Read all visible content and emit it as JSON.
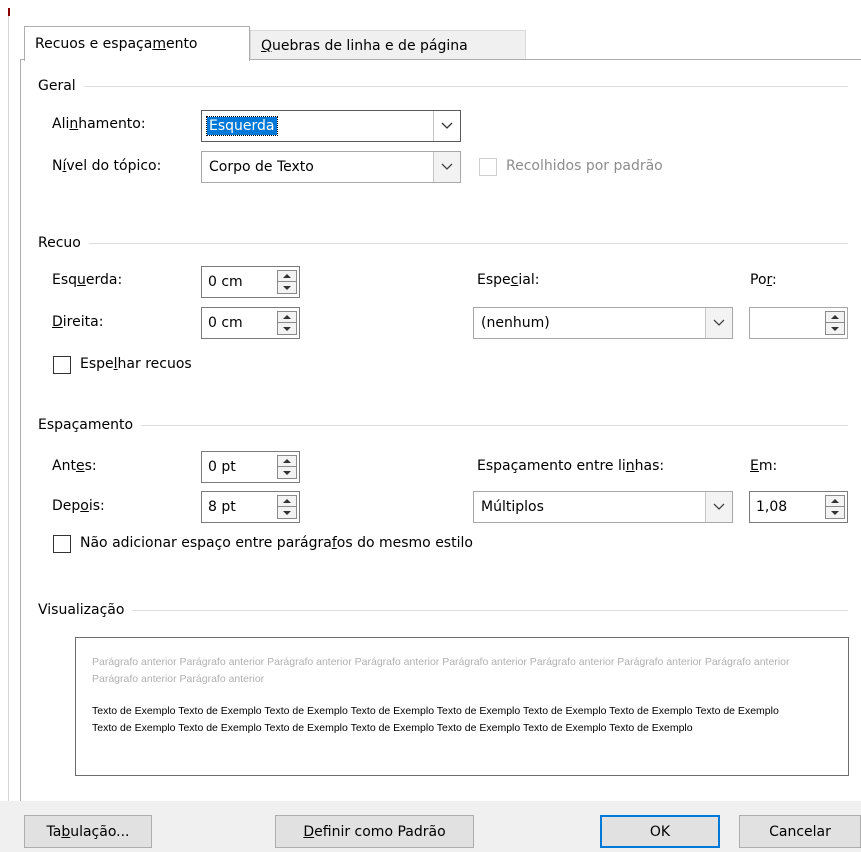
{
  "tabs": {
    "indent_spacing": "Recuos e espaçamento",
    "line_page_breaks": "Quebras de linha e de página"
  },
  "general": {
    "title": "Geral",
    "alignment_label": "Alinhamento:",
    "alignment_value": "Esquerda",
    "outline_label": "Nível do tópico:",
    "outline_value": "Corpo de Texto",
    "collapsed_label": "Recolhidos por padrão"
  },
  "indent": {
    "title": "Recuo",
    "left_label": "Esquerda:",
    "left_value": "0 cm",
    "right_label": "Direita:",
    "right_value": "0 cm",
    "special_label": "Especial:",
    "special_value": "(nenhum)",
    "by_label": "Por:",
    "by_value": "",
    "mirror_label": "Espelhar recuos"
  },
  "spacing": {
    "title": "Espaçamento",
    "before_label": "Antes:",
    "before_value": "0 pt",
    "after_label": "Depois:",
    "after_value": "8 pt",
    "line_spacing_label": "Espaçamento entre linhas:",
    "line_spacing_value": "Múltiplos",
    "at_label": "Em:",
    "at_value": "1,08",
    "no_space_label": "Não adicionar espaço entre parágrafos do mesmo estilo"
  },
  "preview": {
    "title": "Visualização",
    "previous_text": "Parágrafo anterior Parágrafo anterior Parágrafo anterior Parágrafo anterior Parágrafo anterior Parágrafo anterior Parágrafo anterior Parágrafo anterior Parágrafo anterior Parágrafo anterior",
    "sample_text": "Texto de Exemplo Texto de Exemplo Texto de Exemplo Texto de Exemplo Texto de Exemplo Texto de Exemplo Texto de Exemplo Texto de Exemplo Texto de Exemplo Texto de Exemplo Texto de Exemplo Texto de Exemplo Texto de Exemplo Texto de Exemplo Texto de Exemplo"
  },
  "buttons": {
    "tabs": "Tabulação...",
    "set_default": "Definir como Padrão",
    "ok": "OK",
    "cancel": "Cancelar"
  },
  "colors": {
    "accent": "#0078d7",
    "dialog_footer": "#f0f0f0"
  }
}
